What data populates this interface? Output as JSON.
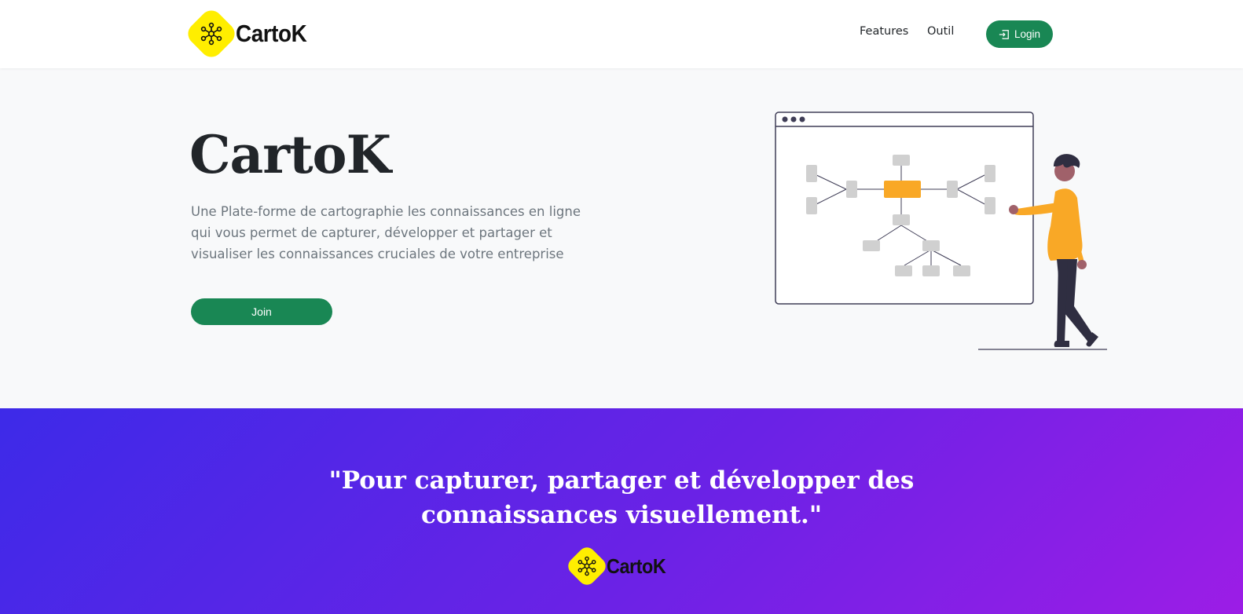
{
  "navbar": {
    "brand": "CartoK",
    "links": [
      "Features",
      "Outil"
    ],
    "login_label": "Login",
    "login_icon": "login-icon"
  },
  "hero": {
    "title": "CartoK",
    "lead": "Une Plate-forme de cartographie les connaissances en ligne qui vous permet de capturer, développer et partager et visualiser les connaissances cruciales de votre entreprise",
    "join_label": "Join"
  },
  "banner": {
    "quote_line1": "\"Pour capturer, partager et développer des",
    "quote_line2": "connaissances visuellement.\"",
    "brand": "CartoK"
  },
  "colors": {
    "primary_green": "#198754",
    "logo_yellow": "#ffee00",
    "accent_orange": "#f9a826",
    "gradient_start": "#3d2ae8",
    "gradient_end": "#9c1de6"
  }
}
